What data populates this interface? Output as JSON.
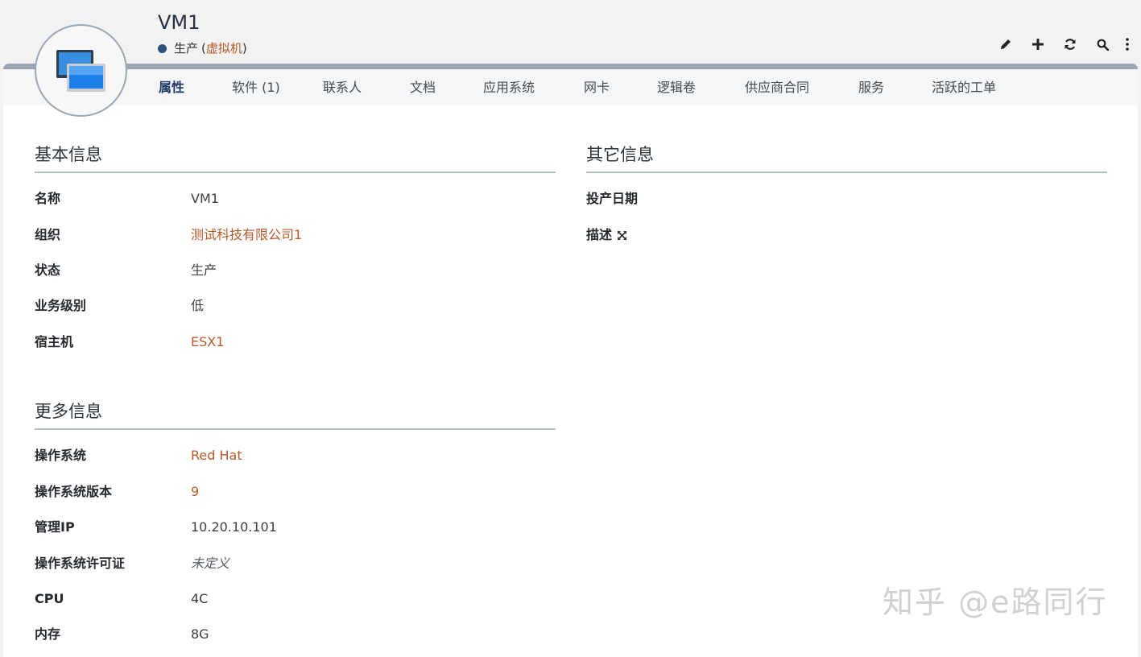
{
  "header": {
    "title": "VM1",
    "status_label": "生产",
    "status_open": "(",
    "status_type": "虚拟机",
    "status_close": ")",
    "status_color": "#2c4f7c"
  },
  "toolbar": {
    "icons": [
      "pencil-icon",
      "plus-icon",
      "refresh-icon",
      "search-icon",
      "more-vertical-icon"
    ]
  },
  "tabs": [
    {
      "label": "属性",
      "active": true
    },
    {
      "label": "软件 (1)"
    },
    {
      "label": "联系人"
    },
    {
      "label": "文档"
    },
    {
      "label": "应用系统"
    },
    {
      "label": "网卡"
    },
    {
      "label": "逻辑卷"
    },
    {
      "label": "供应商合同"
    },
    {
      "label": "服务"
    },
    {
      "label": "活跃的工单"
    }
  ],
  "basic_info": {
    "title": "基本信息",
    "fields": [
      {
        "label": "名称",
        "value": "VM1"
      },
      {
        "label": "组织",
        "value": "测试科技有限公司1"
      },
      {
        "label": "状态",
        "value": "生产"
      },
      {
        "label": "业务级别",
        "value": "低"
      },
      {
        "label": "宿主机",
        "value": "ESX1"
      }
    ]
  },
  "more_info": {
    "title": "更多信息",
    "fields": [
      {
        "label": "操作系统",
        "value": "Red Hat"
      },
      {
        "label": "操作系统版本",
        "value": "9"
      },
      {
        "label": "管理IP",
        "value": "10.20.10.101"
      },
      {
        "label": "操作系统许可证",
        "value": "未定义"
      },
      {
        "label": "CPU",
        "value": "4C"
      },
      {
        "label": "内存",
        "value": "8G"
      }
    ]
  },
  "other_info": {
    "title": "其它信息",
    "fields": [
      {
        "label": "投产日期",
        "value": ""
      },
      {
        "label": "描述",
        "value": ""
      }
    ]
  },
  "colors": {
    "link": "#b55a2a",
    "accent": "#1f3b66",
    "panel_top_border": "#9aa5b3"
  },
  "watermark": "知乎 @e路同行"
}
